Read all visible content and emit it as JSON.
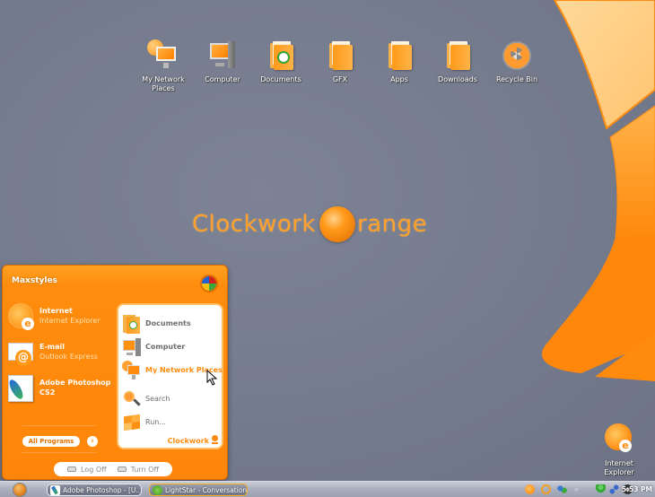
{
  "desktop": {
    "icons": [
      {
        "label": "My Network Places",
        "icon": "network-places-icon"
      },
      {
        "label": "Computer",
        "icon": "computer-icon"
      },
      {
        "label": "Documents",
        "icon": "documents-icon"
      },
      {
        "label": "GFX",
        "icon": "folder-icon"
      },
      {
        "label": "Apps",
        "icon": "folder-icon"
      },
      {
        "label": "Downloads",
        "icon": "folder-icon"
      },
      {
        "label": "Recycle Bin",
        "icon": "recycle-bin-icon"
      }
    ],
    "ie_shortcut": {
      "label": "Internet Explorer",
      "icon": "internet-explorer-icon"
    },
    "logo": {
      "part1": "Clockwork",
      "part2": "range"
    },
    "colors": {
      "accent": "#ff8a0c",
      "background": "#747a8c",
      "accent_light": "#ffcf8a"
    }
  },
  "start_menu": {
    "user": "Maxstyles",
    "pinned": [
      {
        "title": "Internet",
        "subtitle": "Internet Explorer",
        "icon": "internet-explorer-icon"
      },
      {
        "title": "E-mail",
        "subtitle": "Outlook Express",
        "icon": "outlook-express-icon"
      },
      {
        "title": "Adobe Photoshop",
        "subtitle": "CS2",
        "icon": "photoshop-feather-icon"
      }
    ],
    "all_programs": "All Programs",
    "right_items": [
      {
        "label": "Documents",
        "icon": "documents-icon"
      },
      {
        "label": "Computer",
        "icon": "computer-icon"
      },
      {
        "label": "My Network Places",
        "icon": "network-places-icon"
      },
      {
        "label": "Search",
        "icon": "search-icon"
      },
      {
        "label": "Run...",
        "icon": "run-icon"
      }
    ],
    "brand": "Clockwork",
    "log_off": "Log Off",
    "turn_off": "Turn Off"
  },
  "taskbar": {
    "tasks": [
      {
        "label": "Adobe Photoshop - [U...",
        "icon": "photoshop-icon"
      },
      {
        "label": "LightStar - Conversation",
        "icon": "messenger-icon",
        "active": true
      }
    ],
    "tray_chevron": "»",
    "clock": "5:53 PM"
  }
}
